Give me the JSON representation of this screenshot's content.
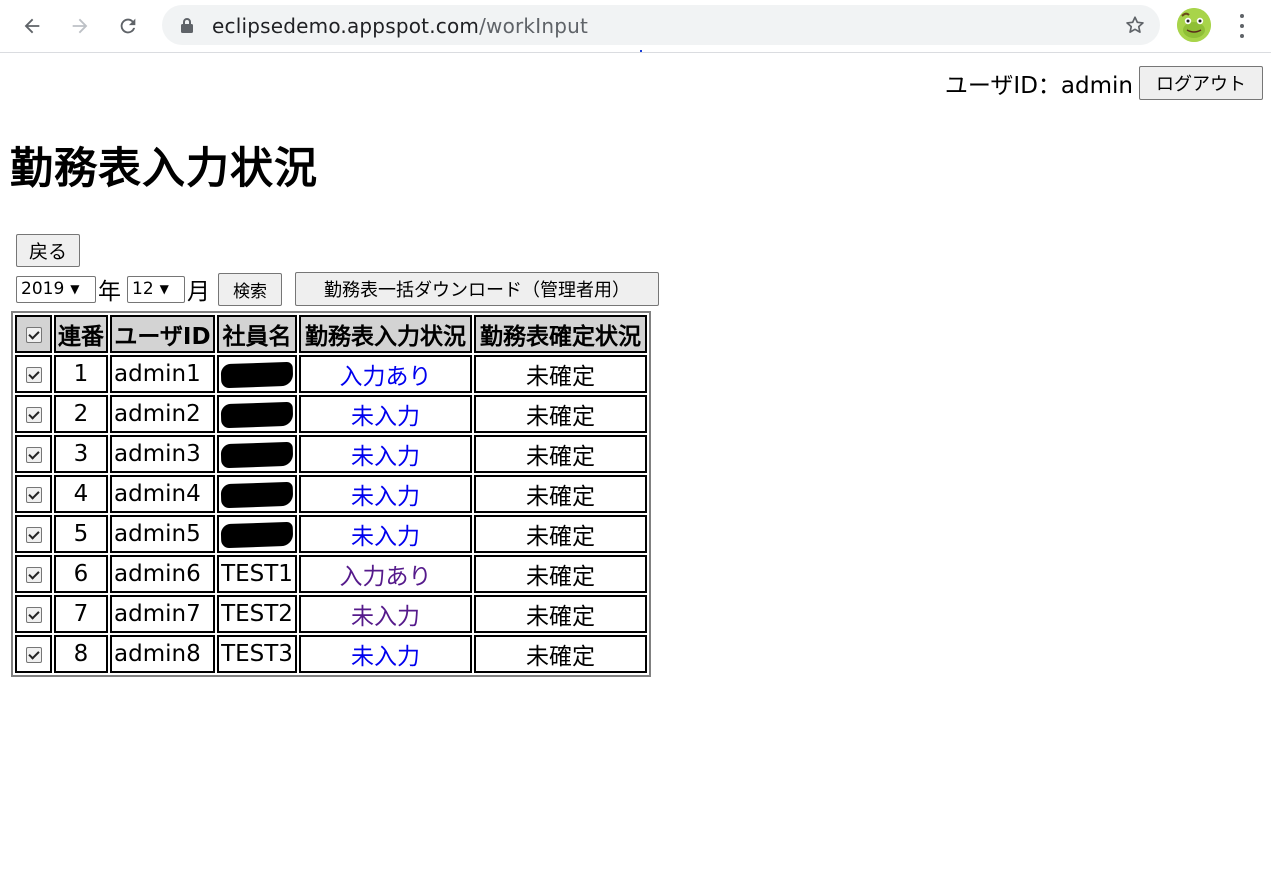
{
  "browser": {
    "url_host": "eclipsedemo.appspot.com",
    "url_path": "/workInput",
    "icons": [
      "back-arrow-icon",
      "forward-arrow-icon",
      "reload-icon",
      "lock-icon",
      "star-icon",
      "profile-avatar-icon",
      "menu-kebab-icon"
    ]
  },
  "header": {
    "user_label": "ユーザID：admin",
    "logout_label": "ログアウト"
  },
  "page": {
    "title": "勤務表入力状況",
    "back_label": "戻る"
  },
  "filters": {
    "year": "2019",
    "year_unit": "年",
    "month": "12",
    "month_unit": "月",
    "search_label": "検索",
    "download_label": "勤務表一括ダウンロード（管理者用）"
  },
  "table": {
    "headers": [
      "連番",
      "ユーザID",
      "社員名",
      "勤務表入力状況",
      "勤務表確定状況"
    ],
    "rows": [
      {
        "no": "1",
        "user_id": "admin1",
        "name": "",
        "status": "入力あり",
        "confirm": "未確定"
      },
      {
        "no": "2",
        "user_id": "admin2",
        "name": "",
        "status": "未入力",
        "confirm": "未確定"
      },
      {
        "no": "3",
        "user_id": "admin3",
        "name": "",
        "status": "未入力",
        "confirm": "未確定"
      },
      {
        "no": "4",
        "user_id": "admin4",
        "name": "",
        "status": "未入力",
        "confirm": "未確定"
      },
      {
        "no": "5",
        "user_id": "admin5",
        "name": "",
        "status": "未入力",
        "confirm": "未確定"
      },
      {
        "no": "6",
        "user_id": "admin6",
        "name": "TEST1",
        "status": "入力あり",
        "confirm": "未確定"
      },
      {
        "no": "7",
        "user_id": "admin7",
        "name": "TEST2",
        "status": "未入力",
        "confirm": "未確定"
      },
      {
        "no": "8",
        "user_id": "admin8",
        "name": "TEST3",
        "status": "未入力",
        "confirm": "未確定"
      }
    ]
  },
  "colors": {
    "link_unvisited": "#0000ee",
    "link_visited": "#551a8b",
    "header_bg": "#d3d3d3"
  }
}
